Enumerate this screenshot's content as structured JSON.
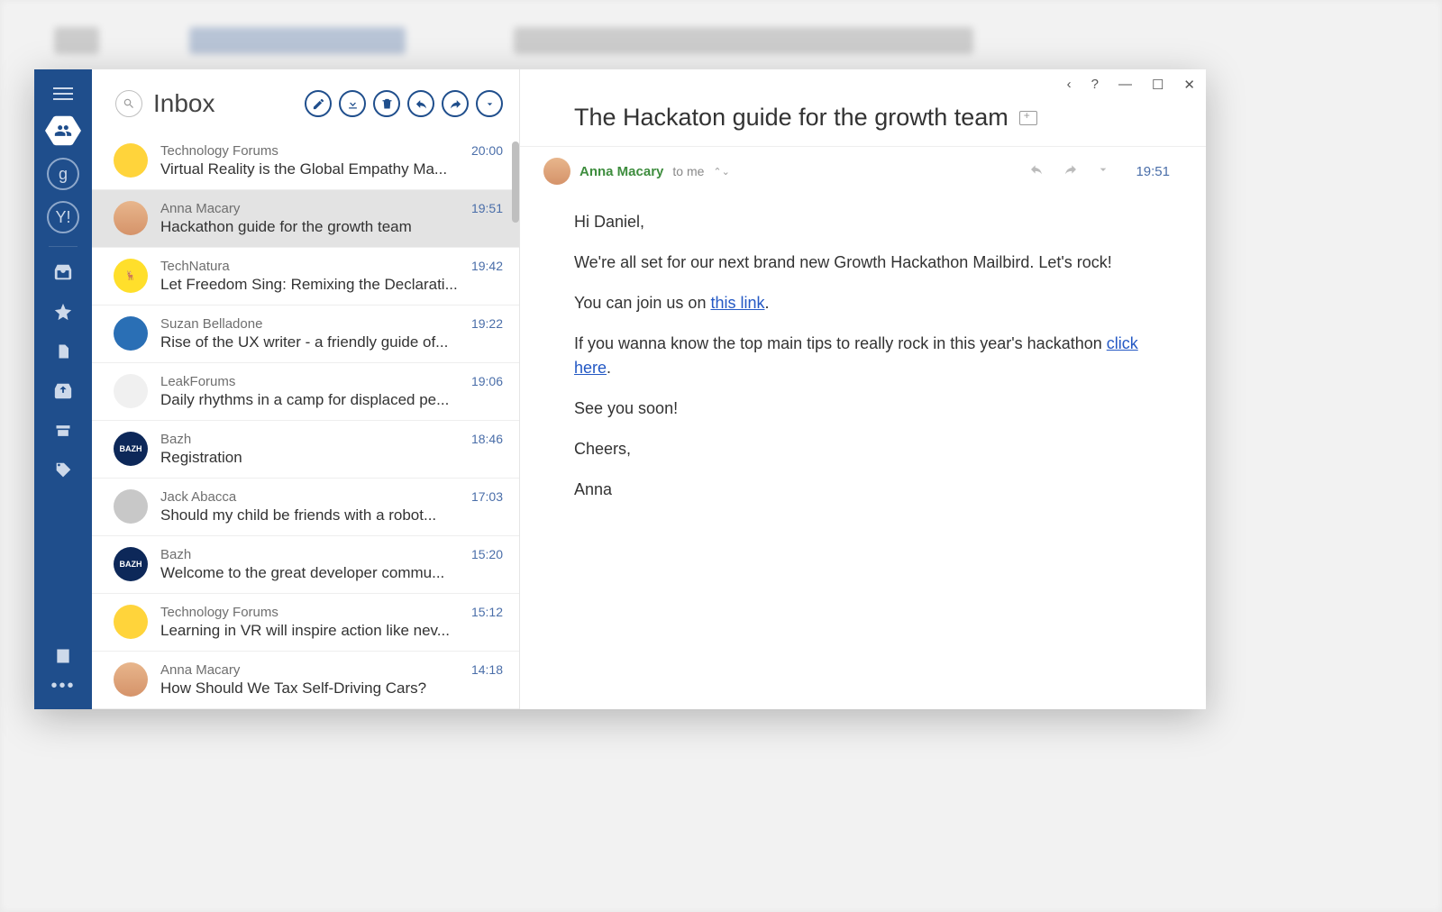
{
  "listHeader": {
    "title": "Inbox"
  },
  "messages": [
    {
      "sender": "Technology Forums",
      "subject": "Virtual Reality is the Global Empathy Ma...",
      "time": "20:00",
      "avatarClass": "av-yellow"
    },
    {
      "sender": "Anna Macary",
      "subject": "Hackathon guide for the growth team",
      "time": "19:51",
      "avatarClass": "av-anna",
      "selected": true
    },
    {
      "sender": "TechNatura",
      "subject": "Let Freedom Sing: Remixing the Declarati...",
      "time": "19:42",
      "avatarClass": "av-nat",
      "avatarText": "🦌"
    },
    {
      "sender": "Suzan Belladone",
      "subject": "Rise of the UX writer - a friendly guide of...",
      "time": "19:22",
      "avatarClass": "av-suzan"
    },
    {
      "sender": "LeakForums",
      "subject": "Daily rhythms in a camp for displaced pe...",
      "time": "19:06",
      "avatarClass": "av-leak"
    },
    {
      "sender": "Bazh",
      "subject": "Registration",
      "time": "18:46",
      "avatarClass": "av-bazh",
      "avatarText": "BAZH"
    },
    {
      "sender": "Jack Abacca",
      "subject": "Should my child be friends with a robot...",
      "time": "17:03",
      "avatarClass": "av-jack"
    },
    {
      "sender": "Bazh",
      "subject": "Welcome to the great developer commu...",
      "time": "15:20",
      "avatarClass": "av-bazh",
      "avatarText": "BAZH"
    },
    {
      "sender": "Technology Forums",
      "subject": "Learning in VR will inspire action like nev...",
      "time": "15:12",
      "avatarClass": "av-yellow"
    },
    {
      "sender": "Anna Macary",
      "subject": "How Should We Tax Self-Driving Cars?",
      "time": "14:18",
      "avatarClass": "av-anna"
    }
  ],
  "reading": {
    "title": "The Hackaton guide for the growth team",
    "from": "Anna Macary",
    "to": "to me",
    "time": "19:51",
    "paragraphs": {
      "p1": "Hi Daniel,",
      "p2": "We're all set for our next brand new Growth Hackathon Mailbird. Let's rock!",
      "p3a": "You can join us on ",
      "p3link": "this link",
      "p3b": ".",
      "p4a": "If you wanna know the top main tips to really rock in this year's hackathon ",
      "p4link": "click here",
      "p4b": ".",
      "p5": "See you soon!",
      "p6": "Cheers,",
      "p7": "Anna"
    }
  },
  "accounts": {
    "google": "g",
    "yahoo": "Y!"
  }
}
